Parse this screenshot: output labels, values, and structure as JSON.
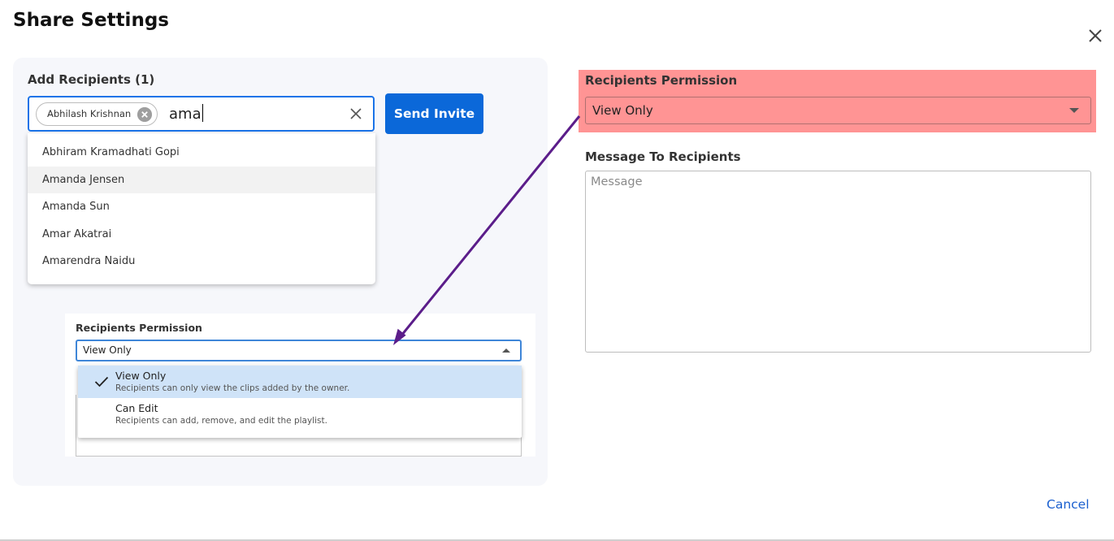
{
  "dialog": {
    "title": "Share Settings"
  },
  "recipients": {
    "label": "Add Recipients (1)",
    "chips": [
      "Abhilash Krishnan"
    ],
    "typed_value": "ama",
    "suggestions": [
      "Abhiram Kramadhati Gopi",
      "Amanda Jensen",
      "Amanda Sun",
      "Amar Akatrai",
      "Amarendra Naidu"
    ],
    "hovered_suggestion": "Amanda Jensen"
  },
  "send_invite_label": "Send Invite",
  "inset": {
    "label": "Recipients Permission",
    "selected": "View Only",
    "options": [
      {
        "title": "View Only",
        "desc": "Recipients can only view the clips added by the owner.",
        "selected": true
      },
      {
        "title": "Can Edit",
        "desc": "Recipients can add, remove, and edit the playlist.",
        "selected": false
      }
    ]
  },
  "permission": {
    "label": "Recipients Permission",
    "value": "View Only"
  },
  "message": {
    "label": "Message To Recipients",
    "placeholder": "Message",
    "value": ""
  },
  "cancel_label": "Cancel",
  "colors": {
    "primary": "#0b68d9",
    "highlight": "#ff9494",
    "selected_option": "#cfe3f8",
    "arrow": "#5b1d8a",
    "link": "#1a5fcf"
  },
  "icons": [
    "close-icon",
    "chip-remove-icon",
    "clear-icon",
    "check-icon",
    "caret-up-icon",
    "caret-down-icon"
  ]
}
